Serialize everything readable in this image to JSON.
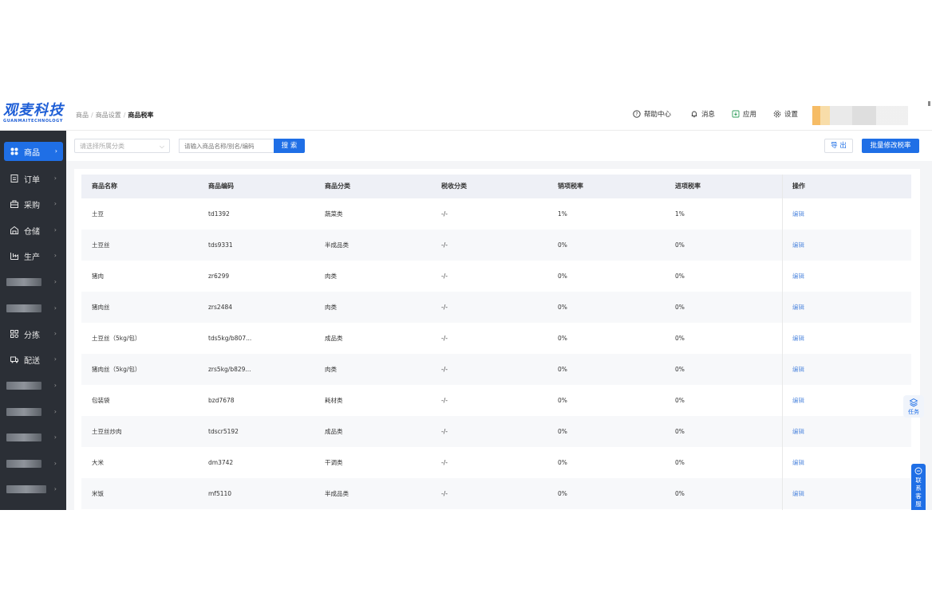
{
  "brand": {
    "name": "观麦科技",
    "sub": "GUANMAITECHNOLOGY",
    "color": "#1f5fd6"
  },
  "breadcrumb": [
    "商品",
    "商品设置",
    "商品税率"
  ],
  "header": {
    "help": "帮助中心",
    "messages": "消息",
    "apps": "应用",
    "settings": "设置"
  },
  "sidebar": {
    "items": [
      {
        "label": "商品",
        "icon": "goods-icon",
        "active": true
      },
      {
        "label": "订单",
        "icon": "order-icon"
      },
      {
        "label": "采购",
        "icon": "purchase-icon"
      },
      {
        "label": "仓储",
        "icon": "warehouse-icon"
      },
      {
        "label": "生产",
        "icon": "production-icon"
      },
      {
        "label": "分拣",
        "icon": "sorting-icon"
      },
      {
        "label": "配送",
        "icon": "delivery-icon"
      }
    ]
  },
  "toolbar": {
    "category_placeholder": "请选择所属分类",
    "search_placeholder": "请输入商品名称/别名/编码",
    "search_label": "搜 索",
    "export_label": "导 出",
    "batch_label": "批量修改税率"
  },
  "table": {
    "columns": [
      "商品名称",
      "商品编码",
      "商品分类",
      "税收分类",
      "销项税率",
      "进项税率",
      "操作"
    ],
    "rows": [
      [
        "土豆",
        "td1392",
        "蔬菜类",
        "-/-",
        "1%",
        "1%",
        "编辑"
      ],
      [
        "土豆丝",
        "tds9331",
        "半成品类",
        "-/-",
        "0%",
        "0%",
        "编辑"
      ],
      [
        "猪肉",
        "zr6299",
        "肉类",
        "-/-",
        "0%",
        "0%",
        "编辑"
      ],
      [
        "猪肉丝",
        "zrs2484",
        "肉类",
        "-/-",
        "0%",
        "0%",
        "编辑"
      ],
      [
        "土豆丝（5kg/包）",
        "tds5kg/b807...",
        "成品类",
        "-/-",
        "0%",
        "0%",
        "编辑"
      ],
      [
        "猪肉丝（5kg/包）",
        "zrs5kg/b829...",
        "肉类",
        "-/-",
        "0%",
        "0%",
        "编辑"
      ],
      [
        "包装袋",
        "bzd7678",
        "耗材类",
        "-/-",
        "0%",
        "0%",
        "编辑"
      ],
      [
        "土豆丝炒肉",
        "tdscr5192",
        "成品类",
        "-/-",
        "0%",
        "0%",
        "编辑"
      ],
      [
        "大米",
        "dm3742",
        "干调类",
        "-/-",
        "0%",
        "0%",
        "编辑"
      ],
      [
        "米饭",
        "mf5110",
        "半成品类",
        "-/-",
        "0%",
        "0%",
        "编辑"
      ]
    ]
  },
  "floating": {
    "task": "任务",
    "contact": "联系客服"
  },
  "colors": {
    "primary": "#1f6fe6",
    "sidebar": "#2b2f36",
    "link": "#5b8fe0"
  }
}
